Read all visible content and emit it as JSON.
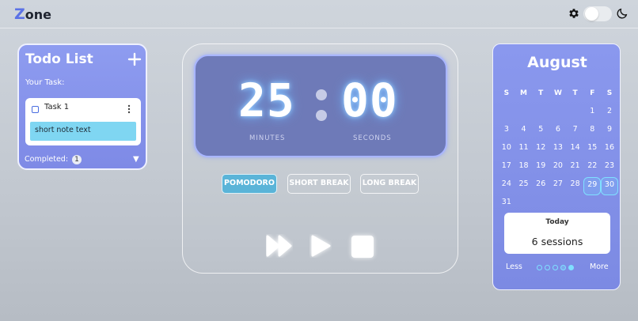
{
  "header": {
    "logo_first": "Z",
    "logo_rest": "one",
    "icons": [
      "gear-icon",
      "moon-icon"
    ]
  },
  "todo": {
    "title": "Todo List",
    "your_task": "Your Task:",
    "tasks": [
      {
        "name": "Task 1",
        "note": "short note text"
      }
    ],
    "completed_label": "Completed:",
    "completed_count": "1"
  },
  "timer": {
    "minutes": "25",
    "seconds": "00",
    "minutes_label": "MINUTES",
    "seconds_label": "SECONDS",
    "modes": [
      "POMODORO",
      "SHORT BREAK",
      "LONG BREAK"
    ],
    "active_mode": "POMODORO",
    "accent": "#5ab4d8"
  },
  "calendar": {
    "month": "August",
    "weekdays": [
      "S",
      "M",
      "T",
      "W",
      "T",
      "F",
      "S"
    ],
    "weeks": [
      [
        "",
        "",
        "",
        "",
        "",
        "1",
        "2"
      ],
      [
        "3",
        "4",
        "5",
        "6",
        "7",
        "8",
        "9"
      ],
      [
        "10",
        "11",
        "12",
        "13",
        "14",
        "15",
        "16"
      ],
      [
        "17",
        "18",
        "19",
        "20",
        "21",
        "22",
        "23"
      ],
      [
        "24",
        "25",
        "26",
        "27",
        "28",
        "29",
        "30"
      ],
      [
        "31",
        "",
        "",
        "",
        "",
        "",
        ""
      ]
    ],
    "highlighted_days": [
      "29",
      "30"
    ],
    "today_label": "Today",
    "sessions_text": "6 sessions",
    "legend_less": "Less",
    "legend_more": "More"
  }
}
